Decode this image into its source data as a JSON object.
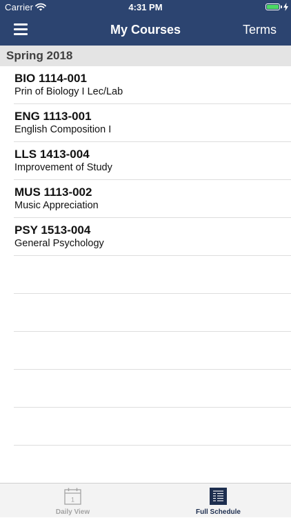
{
  "status": {
    "carrier": "Carrier",
    "time": "4:31 PM",
    "battery_level": 1.0,
    "battery_color": "#4cd964",
    "icons": [
      "wifi-icon",
      "battery-icon",
      "charging-bolt-icon"
    ]
  },
  "nav": {
    "title": "My Courses",
    "right_button": "Terms",
    "left_icon": "hamburger-menu-icon"
  },
  "section": {
    "title": "Spring 2018"
  },
  "courses": [
    {
      "code": "BIO 1114-001",
      "name": "Prin of Biology I Lec/Lab"
    },
    {
      "code": "ENG 1113-001",
      "name": "English Composition I"
    },
    {
      "code": "LLS 1413-004",
      "name": "Improvement of Study"
    },
    {
      "code": "MUS 1113-002",
      "name": "Music Appreciation"
    },
    {
      "code": "PSY 1513-004",
      "name": "General Psychology"
    }
  ],
  "tabs": [
    {
      "label": "Daily View",
      "icon": "calendar-icon",
      "icon_text": "1",
      "selected": false
    },
    {
      "label": "Full Schedule",
      "icon": "schedule-list-icon",
      "selected": true
    }
  ],
  "colors": {
    "nav_background": "#2c4470",
    "section_background": "#e4e4e4",
    "tab_active": "#1d2e4f",
    "tab_inactive": "#a3a3a3"
  }
}
